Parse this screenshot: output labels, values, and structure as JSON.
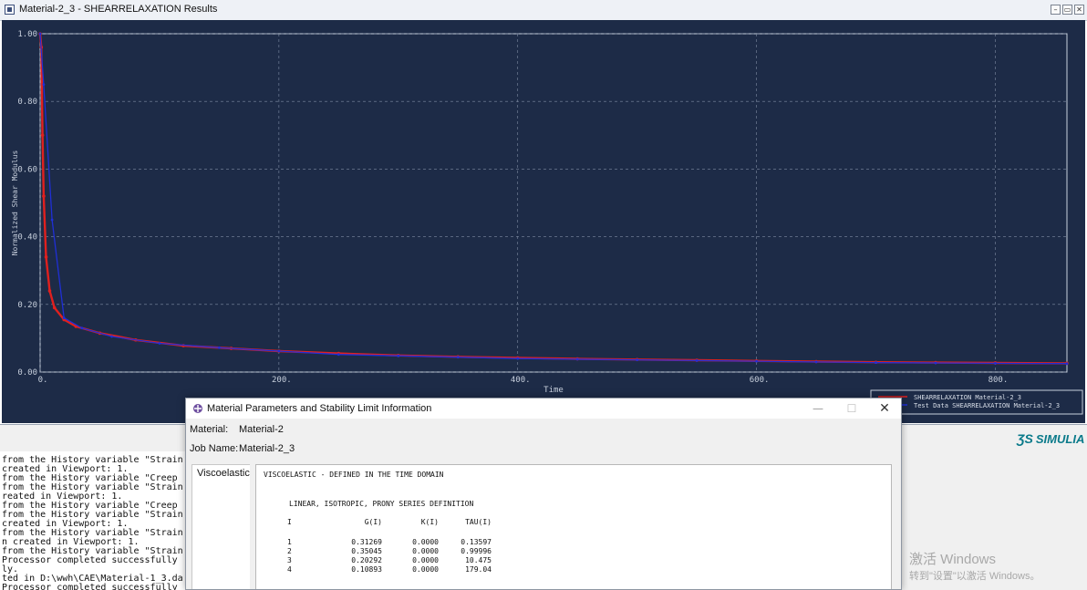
{
  "viewport": {
    "title": "Material-2_3 - SHEARRELAXATION Results",
    "controls": {
      "minimize": "–",
      "restore": "▭",
      "close": "✕"
    }
  },
  "chart_data": {
    "type": "line",
    "xlabel": "Time",
    "ylabel": "Normalized Shear Modulus",
    "xlim": [
      0,
      860
    ],
    "ylim": [
      0,
      1.0
    ],
    "x_ticks": [
      "0.",
      "200.",
      "400.",
      "600.",
      "800."
    ],
    "x_tick_values": [
      0,
      200,
      400,
      600,
      800
    ],
    "y_ticks": [
      "0.00",
      "0.20",
      "0.40",
      "0.60",
      "0.80",
      "1.00"
    ],
    "y_tick_values": [
      0,
      0.2,
      0.4,
      0.6,
      0.8,
      1.0
    ],
    "grid": true,
    "legend": {
      "position": "bottom-right"
    },
    "series": [
      {
        "name": "SHEARRELAXATION Material-2_3",
        "color": "#e0201e",
        "x": [
          0,
          1,
          2,
          3,
          5,
          8,
          12,
          20,
          30,
          50,
          80,
          120,
          160,
          200,
          250,
          300,
          350,
          400,
          450,
          500,
          550,
          600,
          650,
          700,
          750,
          800,
          860
        ],
        "y": [
          1.0,
          0.96,
          0.7,
          0.52,
          0.34,
          0.24,
          0.19,
          0.155,
          0.135,
          0.115,
          0.095,
          0.078,
          0.07,
          0.062,
          0.055,
          0.049,
          0.045,
          0.042,
          0.039,
          0.037,
          0.035,
          0.033,
          0.031,
          0.029,
          0.028,
          0.027,
          0.026
        ]
      },
      {
        "name": "Test Data SHEARRELAXATION Material-2_3",
        "color": "#1f2fd6",
        "x": [
          0,
          3,
          10,
          20,
          35,
          60,
          100,
          150,
          200,
          250,
          300,
          350,
          400,
          450,
          500,
          550,
          600,
          650,
          700,
          750,
          800,
          860
        ],
        "y": [
          1.0,
          0.85,
          0.45,
          0.16,
          0.13,
          0.105,
          0.085,
          0.072,
          0.062,
          0.052,
          0.048,
          0.044,
          0.04,
          0.038,
          0.036,
          0.034,
          0.032,
          0.03,
          0.028,
          0.027,
          0.026,
          0.025
        ]
      }
    ]
  },
  "messages": [
    "from the History variable \"Strain",
    " created in Viewport: 1.",
    "from the History variable \"Creep",
    "from the History variable \"Strain",
    "reated in Viewport: 1.",
    "from the History variable \"Creep",
    "from the History variable \"Strain",
    " created in Viewport: 1.",
    "from the History variable \"Strain",
    "n created in Viewport: 1.",
    "from the History variable \"Strain",
    " Processor completed successfully",
    "ly.",
    "ted in D:\\wwh\\CAE\\Material-1_3.da",
    " Processor completed successfully"
  ],
  "brand": "SIMULIA",
  "dialog": {
    "title": "Material Parameters and Stability Limit Information",
    "material_label": "Material:",
    "material_value": "Material-2",
    "job_label": "Job Name:",
    "job_value": "Material-2_3",
    "tab": "Viscoelastic",
    "heading": "VISCOELASTIC - DEFINED IN THE TIME DOMAIN",
    "subheading": "LINEAR, ISOTROPIC, PRONY SERIES DEFINITION",
    "columns": [
      "I",
      "G(I)",
      "K(I)",
      "TAU(I)"
    ],
    "rows": [
      [
        "1",
        "0.31269",
        "0.0000",
        "0.13597"
      ],
      [
        "2",
        "0.35045",
        "0.0000",
        "0.99996"
      ],
      [
        "3",
        "0.20292",
        "0.0000",
        "10.475"
      ],
      [
        "4",
        "0.10893",
        "0.0000",
        "179.04"
      ]
    ]
  },
  "watermark": {
    "line1": "激活 Windows",
    "line2": "转到\"设置\"以激活 Windows。"
  }
}
